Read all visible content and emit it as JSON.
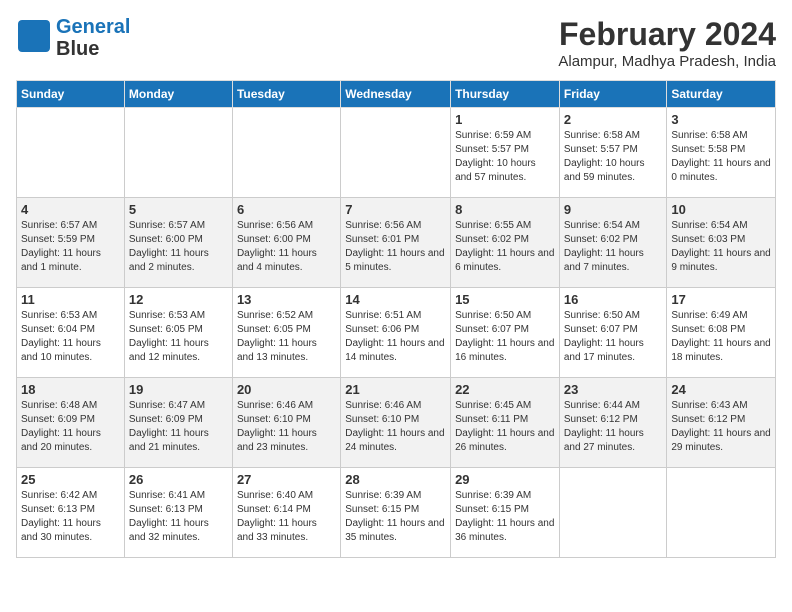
{
  "logo": {
    "line1": "General",
    "line2": "Blue"
  },
  "title": "February 2024",
  "location": "Alampur, Madhya Pradesh, India",
  "days_of_week": [
    "Sunday",
    "Monday",
    "Tuesday",
    "Wednesday",
    "Thursday",
    "Friday",
    "Saturday"
  ],
  "weeks": [
    [
      {
        "day": "",
        "info": ""
      },
      {
        "day": "",
        "info": ""
      },
      {
        "day": "",
        "info": ""
      },
      {
        "day": "",
        "info": ""
      },
      {
        "day": "1",
        "info": "Sunrise: 6:59 AM\nSunset: 5:57 PM\nDaylight: 10 hours and 57 minutes."
      },
      {
        "day": "2",
        "info": "Sunrise: 6:58 AM\nSunset: 5:57 PM\nDaylight: 10 hours and 59 minutes."
      },
      {
        "day": "3",
        "info": "Sunrise: 6:58 AM\nSunset: 5:58 PM\nDaylight: 11 hours and 0 minutes."
      }
    ],
    [
      {
        "day": "4",
        "info": "Sunrise: 6:57 AM\nSunset: 5:59 PM\nDaylight: 11 hours and 1 minute."
      },
      {
        "day": "5",
        "info": "Sunrise: 6:57 AM\nSunset: 6:00 PM\nDaylight: 11 hours and 2 minutes."
      },
      {
        "day": "6",
        "info": "Sunrise: 6:56 AM\nSunset: 6:00 PM\nDaylight: 11 hours and 4 minutes."
      },
      {
        "day": "7",
        "info": "Sunrise: 6:56 AM\nSunset: 6:01 PM\nDaylight: 11 hours and 5 minutes."
      },
      {
        "day": "8",
        "info": "Sunrise: 6:55 AM\nSunset: 6:02 PM\nDaylight: 11 hours and 6 minutes."
      },
      {
        "day": "9",
        "info": "Sunrise: 6:54 AM\nSunset: 6:02 PM\nDaylight: 11 hours and 7 minutes."
      },
      {
        "day": "10",
        "info": "Sunrise: 6:54 AM\nSunset: 6:03 PM\nDaylight: 11 hours and 9 minutes."
      }
    ],
    [
      {
        "day": "11",
        "info": "Sunrise: 6:53 AM\nSunset: 6:04 PM\nDaylight: 11 hours and 10 minutes."
      },
      {
        "day": "12",
        "info": "Sunrise: 6:53 AM\nSunset: 6:05 PM\nDaylight: 11 hours and 12 minutes."
      },
      {
        "day": "13",
        "info": "Sunrise: 6:52 AM\nSunset: 6:05 PM\nDaylight: 11 hours and 13 minutes."
      },
      {
        "day": "14",
        "info": "Sunrise: 6:51 AM\nSunset: 6:06 PM\nDaylight: 11 hours and 14 minutes."
      },
      {
        "day": "15",
        "info": "Sunrise: 6:50 AM\nSunset: 6:07 PM\nDaylight: 11 hours and 16 minutes."
      },
      {
        "day": "16",
        "info": "Sunrise: 6:50 AM\nSunset: 6:07 PM\nDaylight: 11 hours and 17 minutes."
      },
      {
        "day": "17",
        "info": "Sunrise: 6:49 AM\nSunset: 6:08 PM\nDaylight: 11 hours and 18 minutes."
      }
    ],
    [
      {
        "day": "18",
        "info": "Sunrise: 6:48 AM\nSunset: 6:09 PM\nDaylight: 11 hours and 20 minutes."
      },
      {
        "day": "19",
        "info": "Sunrise: 6:47 AM\nSunset: 6:09 PM\nDaylight: 11 hours and 21 minutes."
      },
      {
        "day": "20",
        "info": "Sunrise: 6:46 AM\nSunset: 6:10 PM\nDaylight: 11 hours and 23 minutes."
      },
      {
        "day": "21",
        "info": "Sunrise: 6:46 AM\nSunset: 6:10 PM\nDaylight: 11 hours and 24 minutes."
      },
      {
        "day": "22",
        "info": "Sunrise: 6:45 AM\nSunset: 6:11 PM\nDaylight: 11 hours and 26 minutes."
      },
      {
        "day": "23",
        "info": "Sunrise: 6:44 AM\nSunset: 6:12 PM\nDaylight: 11 hours and 27 minutes."
      },
      {
        "day": "24",
        "info": "Sunrise: 6:43 AM\nSunset: 6:12 PM\nDaylight: 11 hours and 29 minutes."
      }
    ],
    [
      {
        "day": "25",
        "info": "Sunrise: 6:42 AM\nSunset: 6:13 PM\nDaylight: 11 hours and 30 minutes."
      },
      {
        "day": "26",
        "info": "Sunrise: 6:41 AM\nSunset: 6:13 PM\nDaylight: 11 hours and 32 minutes."
      },
      {
        "day": "27",
        "info": "Sunrise: 6:40 AM\nSunset: 6:14 PM\nDaylight: 11 hours and 33 minutes."
      },
      {
        "day": "28",
        "info": "Sunrise: 6:39 AM\nSunset: 6:15 PM\nDaylight: 11 hours and 35 minutes."
      },
      {
        "day": "29",
        "info": "Sunrise: 6:39 AM\nSunset: 6:15 PM\nDaylight: 11 hours and 36 minutes."
      },
      {
        "day": "",
        "info": ""
      },
      {
        "day": "",
        "info": ""
      }
    ]
  ]
}
